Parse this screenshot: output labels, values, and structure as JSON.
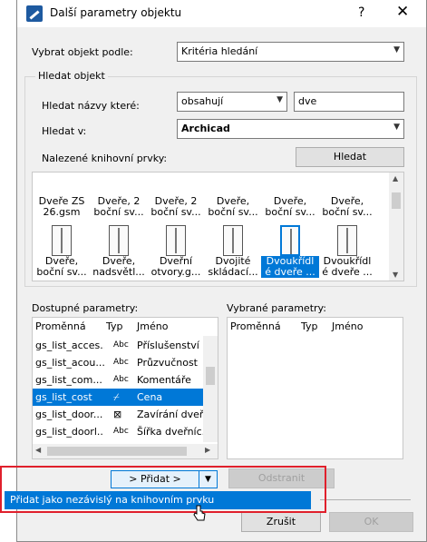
{
  "window": {
    "title": "Další parametry objektu",
    "help": "?",
    "close": "✕"
  },
  "select_by": {
    "label": "Vybrat objekt podle:",
    "value": "Kritéria hledání"
  },
  "find_group": {
    "title": "Hledat objekt"
  },
  "find_names": {
    "label": "Hledat názvy které:",
    "operator": "obsahují",
    "value": "dve"
  },
  "search_in": {
    "label": "Hledat v:",
    "value": "Archicad"
  },
  "found": {
    "label": "Nalezené knihovní prvky:",
    "search_button": "Hledat"
  },
  "library_items": [
    {
      "line1": "Dveře ZS",
      "line2": "26.gsm"
    },
    {
      "line1": "Dveře, 2",
      "line2": "boční sv..."
    },
    {
      "line1": "Dveře, 2",
      "line2": "boční sv..."
    },
    {
      "line1": "Dveře,",
      "line2": "boční sv..."
    },
    {
      "line1": "Dveře,",
      "line2": "boční sv..."
    },
    {
      "line1": "Dveře,",
      "line2": "boční sv..."
    },
    {
      "line1": "Dveře,",
      "line2": "boční sv..."
    },
    {
      "line1": "Dveře,",
      "line2": "nadsvětl..."
    },
    {
      "line1": "Dveřní",
      "line2": "otvory.g..."
    },
    {
      "line1": "Dvojité",
      "line2": "skládací..."
    },
    {
      "line1": "Dvoukřídl",
      "line2": "é dveře ..."
    },
    {
      "line1": "Dvoukřídl",
      "line2": "é dveře ..."
    }
  ],
  "available": {
    "label": "Dostupné parametry:",
    "col_var": "Proměnná",
    "col_type": "Typ",
    "col_name": "Jméno",
    "rows": [
      {
        "var": "gs_list_acces...",
        "type": "Abc",
        "name": "Příslušenství"
      },
      {
        "var": "gs_list_acou...",
        "type": "Abc",
        "name": "Průzvučnost"
      },
      {
        "var": "gs_list_com...",
        "type": "Abc",
        "name": "Komentáře"
      },
      {
        "var": "gs_list_cost",
        "type": "⌿",
        "name": "Cena"
      },
      {
        "var": "gs_list_door...",
        "type": "⊠",
        "name": "Zavírání dveří"
      },
      {
        "var": "gs_list_doorl...",
        "type": "Abc",
        "name": "Šířka dveřníc..."
      }
    ]
  },
  "selected": {
    "label": "Vybrané parametry:",
    "col_var": "Proměnná",
    "col_type": "Typ",
    "col_name": "Jméno"
  },
  "add_button": "> Přidat >",
  "remove_button": "Odstranit",
  "add_menu_item": "Přidat jako nezávislý na knihovním prvku",
  "cancel_button": "Zrušit",
  "ok_button": "OK"
}
